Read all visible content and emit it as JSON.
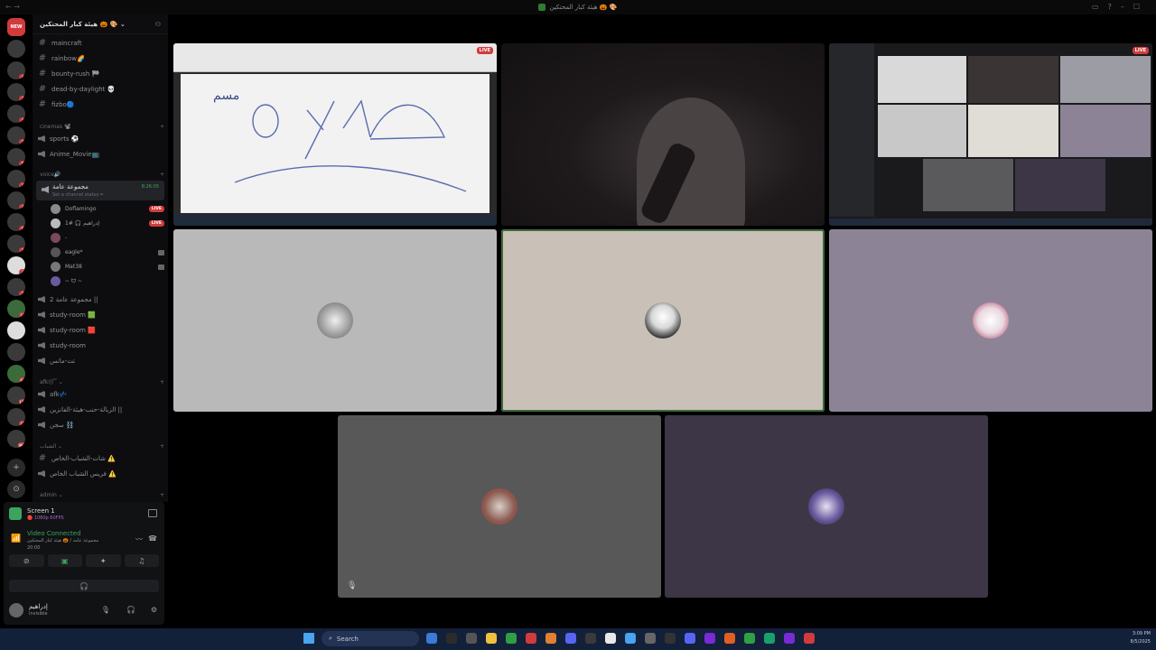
{
  "window": {
    "title": "هيئة كبار المحتكين 🎃 🎨",
    "nav_arrows": "← →"
  },
  "server_rail": {
    "new_badge": "NEW",
    "servers": [
      {
        "badge": ""
      },
      {
        "badge": "4"
      },
      {
        "badge": "3"
      },
      {
        "badge": "1"
      },
      {
        "badge": "2"
      },
      {
        "badge": "5"
      },
      {
        "badge": "1"
      },
      {
        "badge": "4"
      },
      {
        "badge": "6"
      },
      {
        "badge": "1"
      },
      {
        "badge": "3"
      },
      {
        "badge": "1"
      },
      {
        "badge": "11"
      },
      {
        "badge": ""
      },
      {
        "badge": ""
      },
      {
        "badge": "61"
      },
      {
        "badge": "115"
      },
      {
        "badge": "12"
      },
      {
        "badge": "9K+"
      }
    ]
  },
  "sidebar": {
    "guild_name": "هيئة كبار المحتكين 🎃 🎨 ⌄",
    "text_channels": [
      "maincraft",
      "rainbow🌈",
      "bounty-rush 🏁",
      "dead-by-daylight 💀",
      "fizbo🔵"
    ],
    "cat_cinemas": "cinemas 📽️",
    "cinema_channels": [
      "sports ⚽",
      "Anime_Movie📺"
    ],
    "cat_voice": "voice🔊",
    "active_voice": {
      "name": "مجموعة عامة",
      "status": "Set a channel status ✏",
      "timer": "8:26:05"
    },
    "voice_users": [
      {
        "name": "Doflamingo",
        "tag": "LIVE"
      },
      {
        "name": "إدراهيم 🎧 #1",
        "tag": "LIVE"
      },
      {
        "name": "-",
        "tag": ""
      },
      {
        "name": "eagle*",
        "tag": ""
      },
      {
        "name": "Mat38",
        "tag": ""
      },
      {
        "name": "~ ᗢ ~",
        "tag": ""
      }
    ],
    "more_voice": [
      "مجموعة عامة 2 ||",
      "study-room 🟩",
      "study-room 🟥",
      "study-room",
      "تت-ماتس"
    ],
    "cat_afk": "afk😴 ⌄",
    "afk_channels": [
      "afk💤",
      "الزيالة-حنب-هيئة-الفانزين ||",
      "سجن ⛓️"
    ],
    "cat_youth": "الشباب ⌄",
    "youth_channels": [
      "شات-الشباب-الخاص ⚠️",
      "فريس الشباب الخاص ⚠️"
    ],
    "cat_admin": "admin ⌄"
  },
  "panel": {
    "screen_title": "Screen 1",
    "screen_sub": "🔴 1080p 60FPS",
    "vc_status": "Video Connected",
    "vc_location": "مجموعة عامة / 🎃 هيئة كبار المحتكين",
    "vc_time": "20:00",
    "username": "إدراهيم",
    "user_status": "Invisible"
  },
  "tiles": {
    "live_label": "LIVE",
    "whiteboard_text": "مسم"
  },
  "taskbar": {
    "search": "Search",
    "time": "3:09 PM",
    "date": "8/5/2025"
  }
}
